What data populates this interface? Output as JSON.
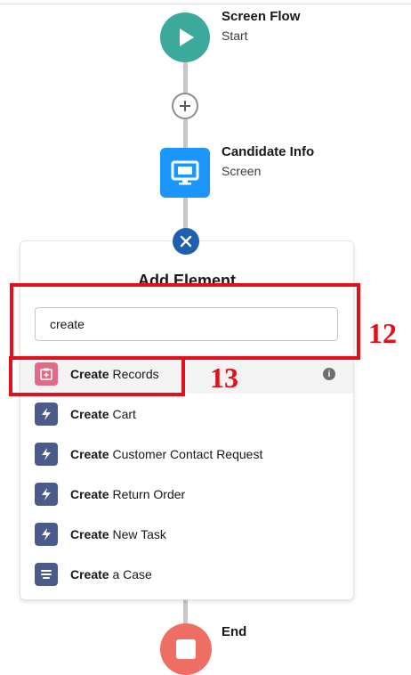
{
  "flow": {
    "start": {
      "title": "Screen Flow",
      "subtitle": "Start",
      "color": "#3ba99c"
    },
    "screen": {
      "title": "Candidate Info",
      "subtitle": "Screen",
      "color": "#1b96ff"
    },
    "end": {
      "title": "End",
      "color": "#ef6e64"
    }
  },
  "panel": {
    "title": "Add Element",
    "search": {
      "value": "create",
      "placeholder": ""
    },
    "items": [
      {
        "bold": "Create",
        "rest": " Records",
        "icon": "create-records-icon",
        "icon_color": "#e3698a",
        "selected": true,
        "info": "i"
      },
      {
        "bold": "Create",
        "rest": " Cart",
        "icon": "lightning-icon",
        "icon_color": "#4a5b8c"
      },
      {
        "bold": "Create",
        "rest": " Customer Contact Request",
        "icon": "lightning-icon",
        "icon_color": "#4a5b8c"
      },
      {
        "bold": "Create",
        "rest": " Return Order",
        "icon": "lightning-icon",
        "icon_color": "#4a5b8c"
      },
      {
        "bold": "Create",
        "rest": " New Task",
        "icon": "lightning-icon",
        "icon_color": "#4a5b8c"
      },
      {
        "bold": "Create",
        "rest": " a Case",
        "icon": "case-icon",
        "icon_color": "#4a5b8c"
      }
    ]
  },
  "annotations": {
    "search_label": "12",
    "item_label": "13",
    "color": "#e0101c"
  }
}
